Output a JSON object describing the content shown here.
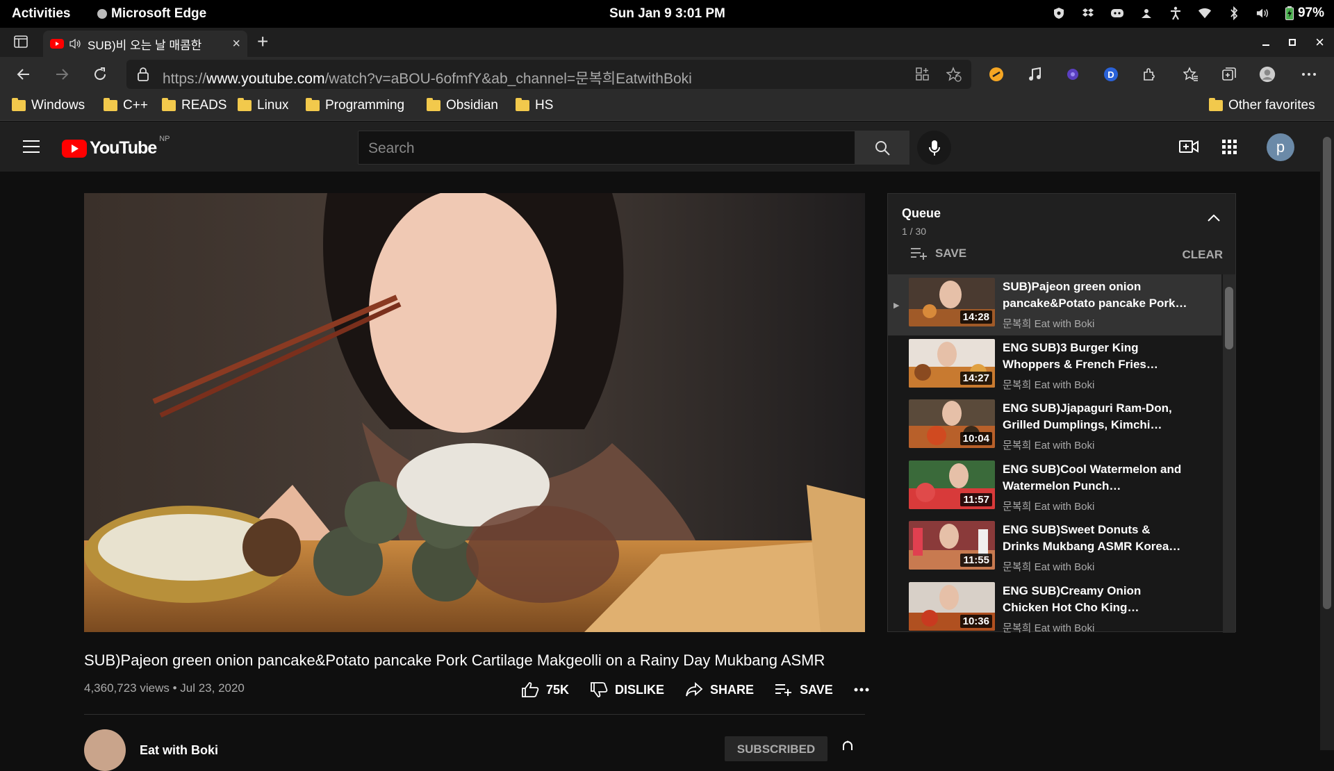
{
  "topbar": {
    "activities": "Activities",
    "app": "Microsoft Edge",
    "clock": "Sun Jan 9  3:01 PM",
    "battery": "97%"
  },
  "tab": {
    "title": "SUB)비 오는 날 매콤한"
  },
  "address": {
    "prefix": "https://",
    "domain": "www.youtube.com",
    "path": "/watch?v=aBOU-6ofmfY&ab_channel=문복희EatwithBoki"
  },
  "favorites": {
    "items": [
      "Windows",
      "C++",
      "READS",
      "Linux",
      "Programming",
      "Obsidian",
      "HS"
    ],
    "other": "Other favorites"
  },
  "youtube": {
    "logo": "YouTube",
    "region": "NP",
    "search_placeholder": "Search",
    "avatar_letter": "p"
  },
  "video": {
    "title": "SUB)Pajeon green onion pancake&Potato pancake Pork Cartilage Makgeolli on a Rainy Day Mukbang ASMR",
    "meta": "4,360,723 views • Jul 23, 2020",
    "likes": "75K",
    "dislike": "DISLIKE",
    "share": "SHARE",
    "save": "SAVE",
    "channel": "Eat with Boki",
    "subscribed": "SUBSCRIBED"
  },
  "queue": {
    "title": "Queue",
    "count": "1 / 30",
    "save": "SAVE",
    "clear": "CLEAR",
    "items": [
      {
        "title": "SUB)Pajeon green onion pancake&Potato pancake Pork…",
        "channel": "문복희 Eat with Boki",
        "duration": "14:28"
      },
      {
        "title": "ENG SUB)3 Burger King Whoppers & French Fries…",
        "channel": "문복희 Eat with Boki",
        "duration": "14:27"
      },
      {
        "title": "ENG SUB)Jjapaguri Ram-Don, Grilled Dumplings, Kimchi…",
        "channel": "문복희 Eat with Boki",
        "duration": "10:04"
      },
      {
        "title": "ENG SUB)Cool Watermelon and Watermelon Punch…",
        "channel": "문복희 Eat with Boki",
        "duration": "11:57"
      },
      {
        "title": "ENG SUB)Sweet Donuts & Drinks Mukbang ASMR Korea…",
        "channel": "문복희 Eat with Boki",
        "duration": "11:55"
      },
      {
        "title": "ENG SUB)Creamy Onion Chicken Hot Cho King…",
        "channel": "문복희 Eat with Boki",
        "duration": "10:36"
      }
    ]
  },
  "colors": {
    "yt_red": "#ff0000",
    "background": "#0f0f0f",
    "folder": "#f2c94c"
  }
}
